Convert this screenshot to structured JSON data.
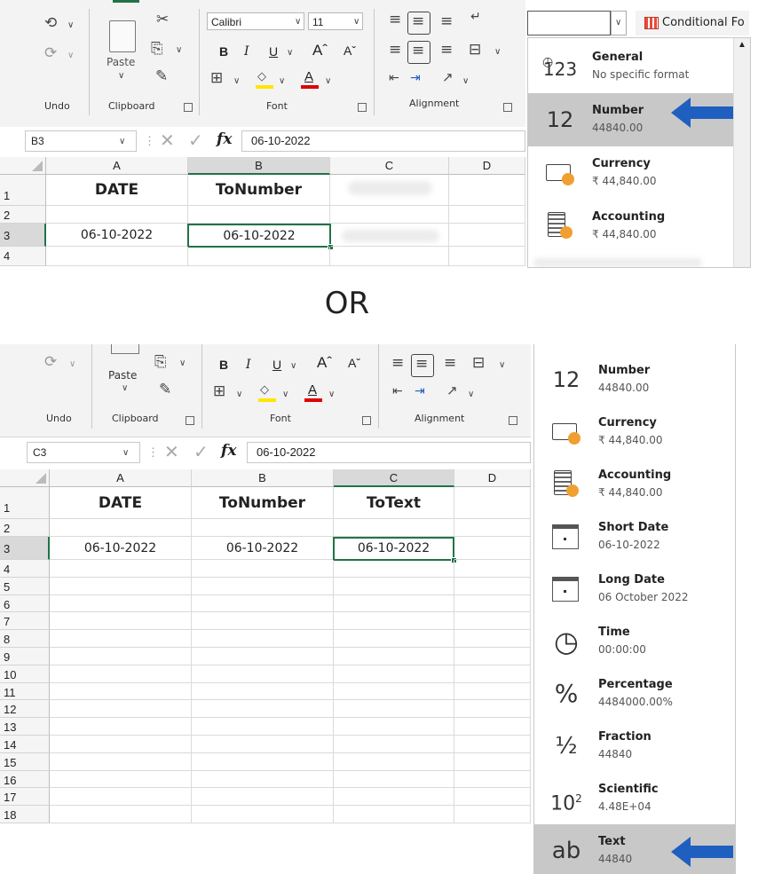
{
  "top": {
    "ribbon": {
      "undo_label": "Undo",
      "clipboard_label": "Clipboard",
      "paste_label": "Paste",
      "font_label": "Font",
      "alignment_label": "Alignment",
      "font_name": "Calibri",
      "font_size": "11",
      "bold": "B",
      "italic": "I",
      "underline": "U",
      "grow_font": "Aˆ",
      "shrink_font": "Aˇ",
      "number_format_value": "",
      "conditional_formatting": "Conditional Fo"
    },
    "formula_bar": {
      "name_box": "B3",
      "fx": "fx",
      "formula": "06-10-2022"
    },
    "columns": [
      "A",
      "B",
      "C",
      "D"
    ],
    "rows": [
      "1",
      "2",
      "3",
      "4"
    ],
    "cells": {
      "A1": "DATE",
      "B1": "ToNumber",
      "A3": "06-10-2022",
      "B3": "06-10-2022"
    },
    "format_menu": [
      {
        "icon": "clock-123-icon",
        "name": "General",
        "sample": "No specific format"
      },
      {
        "icon": "number-12-icon",
        "name": "Number",
        "sample": "44840.00"
      },
      {
        "icon": "currency-icon",
        "name": "Currency",
        "sample": "₹ 44,840.00"
      },
      {
        "icon": "accounting-icon",
        "name": "Accounting",
        "sample": "₹ 44,840.00"
      }
    ],
    "selected_format": "Number",
    "arrow_color": "#1f5fbf"
  },
  "separator_text": "OR",
  "bottom": {
    "ribbon": {
      "undo_label": "Undo",
      "clipboard_label": "Clipboard",
      "paste_label": "Paste",
      "font_label": "Font",
      "alignment_label": "Alignment",
      "bold": "B",
      "italic": "I",
      "underline": "U",
      "grow_font": "Aˆ",
      "shrink_font": "Aˇ"
    },
    "formula_bar": {
      "name_box": "C3",
      "fx": "fx",
      "formula": "06-10-2022"
    },
    "columns": [
      "A",
      "B",
      "C",
      "D"
    ],
    "rows": [
      "1",
      "2",
      "3",
      "4",
      "5",
      "6",
      "7",
      "8",
      "9",
      "10",
      "11",
      "12",
      "13",
      "14",
      "15",
      "16",
      "17",
      "18"
    ],
    "cells": {
      "A1": "DATE",
      "B1": "ToNumber",
      "C1": "ToText",
      "A3": "06-10-2022",
      "B3": "06-10-2022",
      "C3": "06-10-2022"
    },
    "format_menu": [
      {
        "icon": "number-12-icon",
        "name": "Number",
        "sample": "44840.00"
      },
      {
        "icon": "currency-icon",
        "name": "Currency",
        "sample": "₹ 44,840.00"
      },
      {
        "icon": "accounting-icon",
        "name": "Accounting",
        "sample": "₹ 44,840.00"
      },
      {
        "icon": "short-date-icon",
        "name": "Short Date",
        "sample": "06-10-2022"
      },
      {
        "icon": "long-date-icon",
        "name": "Long Date",
        "sample": "06 October 2022"
      },
      {
        "icon": "clock-icon",
        "name": "Time",
        "sample": "00:00:00"
      },
      {
        "icon": "percent-icon",
        "name": "Percentage",
        "sample": "4484000.00%"
      },
      {
        "icon": "fraction-icon",
        "name": "Fraction",
        "sample": "44840"
      },
      {
        "icon": "scientific-icon",
        "name": "Scientific",
        "sample": "4.48E+04"
      },
      {
        "icon": "text-ab-icon",
        "name": "Text",
        "sample": "44840"
      }
    ],
    "selected_format": "Text",
    "arrow_color": "#1f5fbf"
  }
}
